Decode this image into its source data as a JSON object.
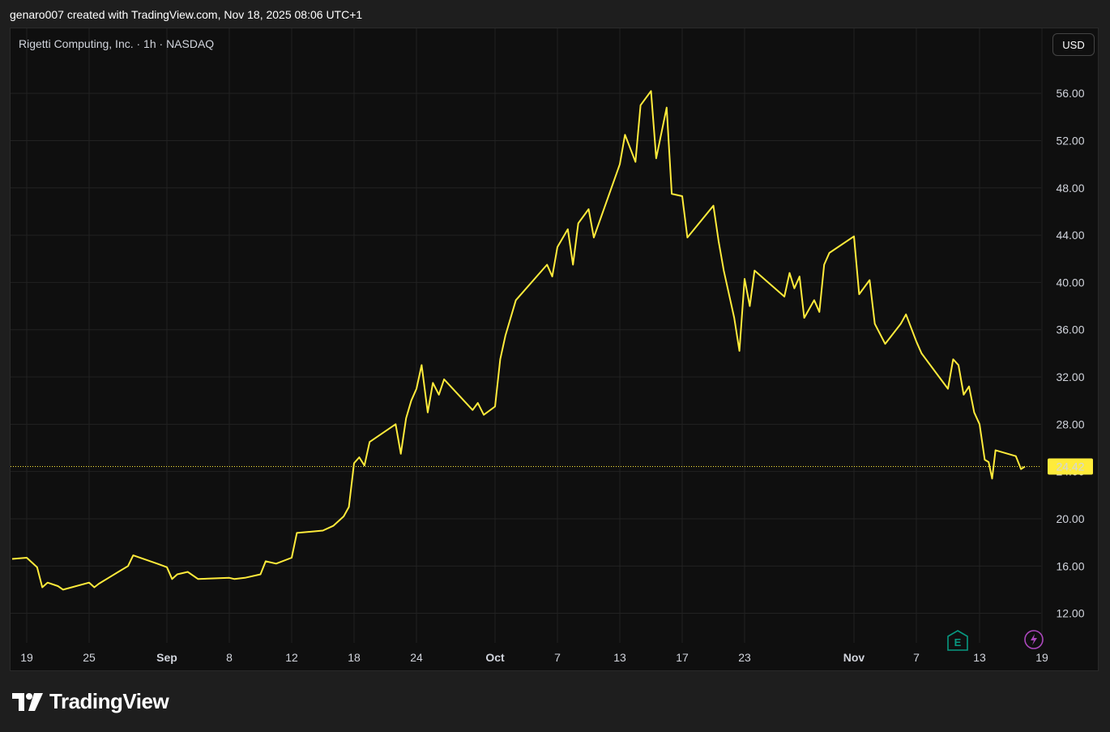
{
  "header": {
    "attribution": "genaro007 created with TradingView.com, Nov 18, 2025 08:06 UTC+1"
  },
  "chart_header": {
    "symbol": "Rigetti Computing, Inc. · 1h · NASDAQ",
    "currency_button": "USD"
  },
  "footer": {
    "brand": "TradingView"
  },
  "markers": {
    "earnings_label": "E",
    "earnings_color": "#089981",
    "flash_color": "#ab47bc"
  },
  "chart_data": {
    "type": "line",
    "title": "",
    "xlabel": "",
    "ylabel": "",
    "line_color": "#ffeb3b",
    "grid": true,
    "last_price": 24.42,
    "ylim": [
      9.5,
      61.5
    ],
    "y_ticks": [
      "56.00",
      "52.00",
      "48.00",
      "44.00",
      "40.00",
      "36.00",
      "32.00",
      "28.00",
      "24.00",
      "20.00",
      "16.00",
      "12.00"
    ],
    "x_ticks": [
      {
        "label": "19",
        "x": "2025-08-19"
      },
      {
        "label": "25",
        "x": "2025-08-25"
      },
      {
        "label": "Sep",
        "x": "2025-09-02"
      },
      {
        "label": "8",
        "x": "2025-09-08"
      },
      {
        "label": "12",
        "x": "2025-09-12"
      },
      {
        "label": "18",
        "x": "2025-09-18"
      },
      {
        "label": "24",
        "x": "2025-09-24"
      },
      {
        "label": "Oct",
        "x": "2025-10-01"
      },
      {
        "label": "7",
        "x": "2025-10-07"
      },
      {
        "label": "13",
        "x": "2025-10-13"
      },
      {
        "label": "17",
        "x": "2025-10-17"
      },
      {
        "label": "23",
        "x": "2025-10-23"
      },
      {
        "label": "Nov",
        "x": "2025-11-03"
      },
      {
        "label": "7",
        "x": "2025-11-07"
      },
      {
        "label": "13",
        "x": "2025-11-13"
      },
      {
        "label": "19",
        "x": "2025-11-19"
      }
    ],
    "series": [
      {
        "values": [
          [
            "2025-08-18",
            16.6
          ],
          [
            "2025-08-19",
            16.7
          ],
          [
            "2025-08-20",
            15.9
          ],
          [
            "2025-08-20",
            14.2
          ],
          [
            "2025-08-21",
            14.6
          ],
          [
            "2025-08-22",
            14.3
          ],
          [
            "2025-08-22",
            14.0
          ],
          [
            "2025-08-25",
            14.6
          ],
          [
            "2025-08-25",
            14.2
          ],
          [
            "2025-08-26",
            14.5
          ],
          [
            "2025-08-27",
            15.0
          ],
          [
            "2025-08-28",
            15.5
          ],
          [
            "2025-08-29",
            16.0
          ],
          [
            "2025-08-29",
            16.9
          ],
          [
            "2025-09-01",
            16.2
          ],
          [
            "2025-09-02",
            15.9
          ],
          [
            "2025-09-02",
            14.9
          ],
          [
            "2025-09-03",
            15.3
          ],
          [
            "2025-09-04",
            15.5
          ],
          [
            "2025-09-05",
            14.9
          ],
          [
            "2025-09-08",
            15.0
          ],
          [
            "2025-09-08",
            14.9
          ],
          [
            "2025-09-09",
            15.0
          ],
          [
            "2025-09-10",
            15.3
          ],
          [
            "2025-09-10",
            16.4
          ],
          [
            "2025-09-11",
            16.2
          ],
          [
            "2025-09-12",
            16.7
          ],
          [
            "2025-09-12",
            18.8
          ],
          [
            "2025-09-15",
            19.0
          ],
          [
            "2025-09-16",
            19.4
          ],
          [
            "2025-09-17",
            20.2
          ],
          [
            "2025-09-17",
            21.0
          ],
          [
            "2025-09-18",
            24.7
          ],
          [
            "2025-09-18",
            25.2
          ],
          [
            "2025-09-19",
            24.5
          ],
          [
            "2025-09-19",
            26.5
          ],
          [
            "2025-09-22",
            28.0
          ],
          [
            "2025-09-22",
            25.5
          ],
          [
            "2025-09-23",
            28.5
          ],
          [
            "2025-09-23",
            30.0
          ],
          [
            "2025-09-24",
            31.0
          ],
          [
            "2025-09-24",
            33.0
          ],
          [
            "2025-09-25",
            29.0
          ],
          [
            "2025-09-25",
            31.5
          ],
          [
            "2025-09-26",
            30.5
          ],
          [
            "2025-09-26",
            31.8
          ],
          [
            "2025-09-29",
            29.2
          ],
          [
            "2025-09-29",
            29.8
          ],
          [
            "2025-09-30",
            28.8
          ],
          [
            "2025-10-01",
            29.5
          ],
          [
            "2025-10-01",
            33.5
          ],
          [
            "2025-10-02",
            35.5
          ],
          [
            "2025-10-03",
            38.5
          ],
          [
            "2025-10-06",
            41.5
          ],
          [
            "2025-10-06",
            40.5
          ],
          [
            "2025-10-07",
            43.0
          ],
          [
            "2025-10-08",
            44.5
          ],
          [
            "2025-10-08",
            41.5
          ],
          [
            "2025-10-09",
            45.0
          ],
          [
            "2025-10-10",
            46.2
          ],
          [
            "2025-10-10",
            43.8
          ],
          [
            "2025-10-13",
            50.0
          ],
          [
            "2025-10-13",
            52.5
          ],
          [
            "2025-10-14",
            50.2
          ],
          [
            "2025-10-14",
            55.0
          ],
          [
            "2025-10-15",
            56.2
          ],
          [
            "2025-10-15",
            50.5
          ],
          [
            "2025-10-16",
            54.8
          ],
          [
            "2025-10-16",
            47.5
          ],
          [
            "2025-10-17",
            47.3
          ],
          [
            "2025-10-17",
            43.8
          ],
          [
            "2025-10-20",
            46.5
          ],
          [
            "2025-10-20",
            43.5
          ],
          [
            "2025-10-21",
            41.0
          ],
          [
            "2025-10-22",
            37.0
          ],
          [
            "2025-10-22",
            34.2
          ],
          [
            "2025-10-23",
            40.3
          ],
          [
            "2025-10-23",
            38.0
          ],
          [
            "2025-10-24",
            41.0
          ],
          [
            "2025-10-27",
            38.8
          ],
          [
            "2025-10-27",
            40.8
          ],
          [
            "2025-10-28",
            39.5
          ],
          [
            "2025-10-28",
            40.5
          ],
          [
            "2025-10-29",
            37.0
          ],
          [
            "2025-10-30",
            38.5
          ],
          [
            "2025-10-30",
            37.5
          ],
          [
            "2025-10-31",
            41.5
          ],
          [
            "2025-10-31",
            42.5
          ],
          [
            "2025-11-03",
            43.9
          ],
          [
            "2025-11-03",
            39.0
          ],
          [
            "2025-11-04",
            40.2
          ],
          [
            "2025-11-04",
            36.5
          ],
          [
            "2025-11-05",
            34.8
          ],
          [
            "2025-11-06",
            36.5
          ],
          [
            "2025-11-06",
            37.3
          ],
          [
            "2025-11-07",
            35.0
          ],
          [
            "2025-11-07",
            34.0
          ],
          [
            "2025-11-10",
            31.0
          ],
          [
            "2025-11-10",
            33.5
          ],
          [
            "2025-11-11",
            33.0
          ],
          [
            "2025-11-11",
            30.5
          ],
          [
            "2025-11-12",
            31.2
          ],
          [
            "2025-11-12",
            29.0
          ],
          [
            "2025-11-13",
            28.0
          ],
          [
            "2025-11-13",
            25.0
          ],
          [
            "2025-11-14",
            24.8
          ],
          [
            "2025-11-14",
            23.4
          ],
          [
            "2025-11-14",
            25.8
          ],
          [
            "2025-11-17",
            25.3
          ],
          [
            "2025-11-17",
            24.2
          ],
          [
            "2025-11-18",
            24.42
          ]
        ]
      }
    ]
  }
}
